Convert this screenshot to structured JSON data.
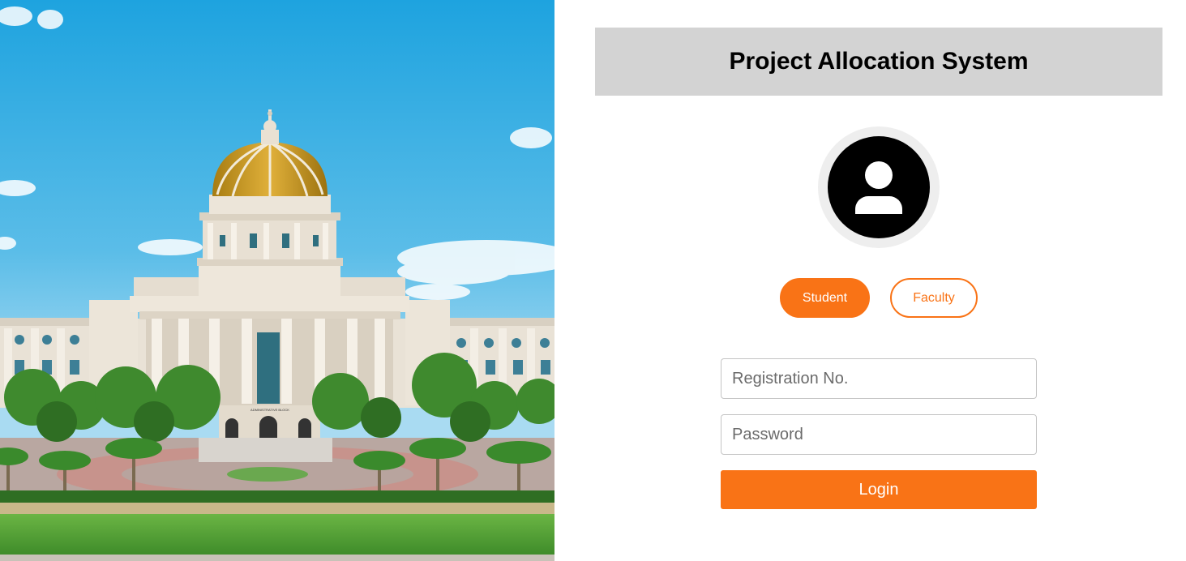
{
  "header": {
    "title": "Project Allocation System"
  },
  "avatar": {
    "icon": "user-icon"
  },
  "roles": {
    "student_label": "Student",
    "faculty_label": "Faculty",
    "selected": "Student"
  },
  "form": {
    "registration_placeholder": "Registration No.",
    "registration_value": "",
    "password_placeholder": "Password",
    "password_value": "",
    "login_label": "Login"
  },
  "campus_image": {
    "sign_text": "ADMINISTRATIVE BLOCK"
  },
  "colors": {
    "accent": "#f97316",
    "title_bar": "#d3d3d3",
    "avatar_bg": "#000000",
    "avatar_ring": "#eeeeee"
  }
}
